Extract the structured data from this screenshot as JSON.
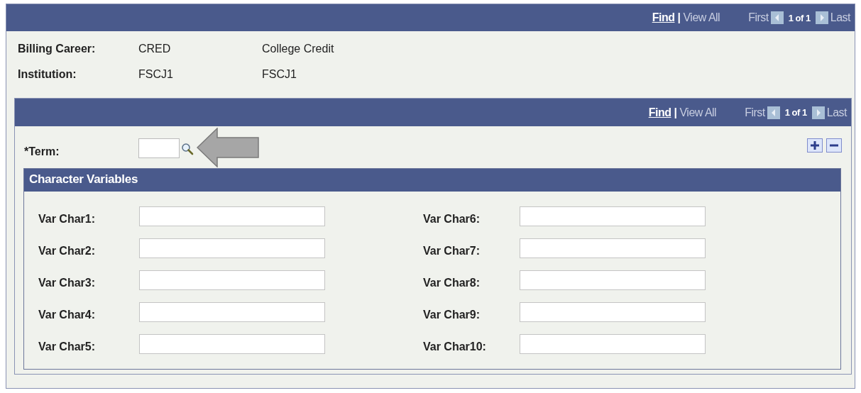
{
  "header_nav": {
    "find": "Find",
    "separator": "|",
    "view_all": "View All",
    "first": "First",
    "counter": "1 of 1",
    "last": "Last"
  },
  "fields": [
    {
      "label": "Billing Career:",
      "value": "CRED",
      "description": "College Credit"
    },
    {
      "label": "Institution:",
      "value": "FSCJ1",
      "description": "FSCJ1"
    }
  ],
  "term_nav": {
    "find": "Find",
    "separator": "|",
    "view_all": "View All",
    "first": "First",
    "counter": "1 of 1",
    "last": "Last"
  },
  "term": {
    "label": "*Term:"
  },
  "character_variables": {
    "title": "Character Variables",
    "left": [
      "Var Char1:",
      "Var Char2:",
      "Var Char3:",
      "Var Char4:",
      "Var Char5:"
    ],
    "right": [
      "Var Char6:",
      "Var Char7:",
      "Var Char8:",
      "Var Char9:",
      "Var Char10:"
    ]
  }
}
